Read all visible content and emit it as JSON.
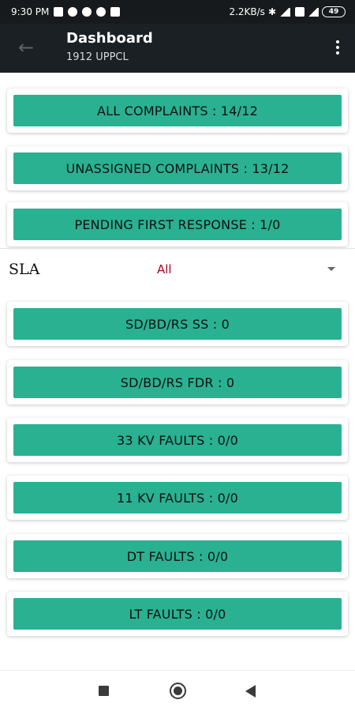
{
  "status_bar": {
    "time": "9:30 PM",
    "speed": "2.2KB/s",
    "battery": "49"
  },
  "app_bar": {
    "title": "Dashboard",
    "subtitle": "1912 UPPCL"
  },
  "summary_buttons": [
    {
      "label": "ALL COMPLAINTS : 14/12"
    },
    {
      "label": "UNASSIGNED COMPLAINTS : 13/12"
    },
    {
      "label": "PENDING FIRST RESPONSE : 1/0"
    }
  ],
  "sla": {
    "label": "SLA",
    "selected": "All"
  },
  "fault_buttons": [
    {
      "label": "SD/BD/RS SS : 0"
    },
    {
      "label": "SD/BD/RS FDR : 0"
    },
    {
      "label": "33 KV FAULTS : 0/0"
    },
    {
      "label": "11 KV FAULTS : 0/0"
    },
    {
      "label": "DT FAULTS : 0/0"
    },
    {
      "label": "LT FAULTS : 0/0"
    }
  ],
  "colors": {
    "button_green": "#2ab191",
    "app_bar": "#1b2024",
    "sla_value": "#b00020"
  },
  "icons": {
    "back": "arrow-left-icon",
    "menu": "more-vert-icon",
    "nav_recents": "square-icon",
    "nav_home": "circle-icon",
    "nav_back": "triangle-back-icon"
  }
}
